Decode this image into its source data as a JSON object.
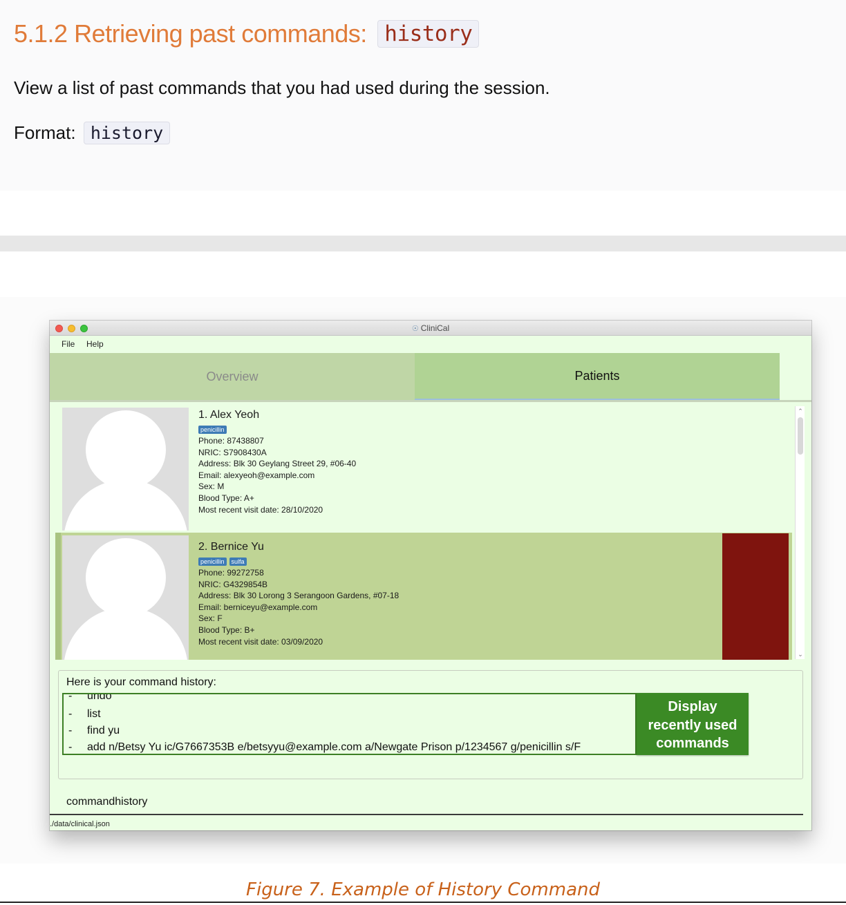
{
  "doc": {
    "heading_text": "5.1.2 Retrieving past commands:",
    "heading_code": "history",
    "description": "View a list of past commands that you had used during the session.",
    "format_label": "Format:",
    "format_code": "history",
    "caption": "Figure 7. Example of History Command"
  },
  "window": {
    "title": "CliniCal",
    "menu": {
      "file": "File",
      "help": "Help"
    },
    "tabs": {
      "overview": "Overview",
      "patients": "Patients"
    }
  },
  "patients": [
    {
      "name": "1.  Alex Yeoh",
      "tags": [
        "penicillin"
      ],
      "phone": "Phone: 87438807",
      "nric": "NRIC: S7908430A",
      "address": "Address: Blk 30 Geylang Street 29, #06-40",
      "email": "Email: alexyeoh@example.com",
      "sex": "Sex: M",
      "blood": "Blood Type: A+",
      "visit": "Most recent visit date: 28/10/2020"
    },
    {
      "name": "2.  Bernice Yu",
      "tags": [
        "penicillin",
        "sulfa"
      ],
      "phone": "Phone: 99272758",
      "nric": "NRIC: G4329854B",
      "address": "Address: Blk 30 Lorong 3 Serangoon Gardens, #07-18",
      "email": "Email: berniceyu@example.com",
      "sex": "Sex: F",
      "blood": "Blood Type: B+",
      "visit": "Most recent visit date: 03/09/2020"
    }
  ],
  "result": {
    "title": "Here is your command history:",
    "dash": "-",
    "history": [
      "undo",
      "list",
      "find yu",
      "add n/Betsy Yu ic/G7667353B e/betsyyu@example.com a/Newgate Prison p/1234567 g/penicillin s/F"
    ],
    "callout": [
      "Display",
      "recently used",
      "commands"
    ]
  },
  "command_box": {
    "value": "commandhistory"
  },
  "status_bar": {
    "path": "./data/clinical.json"
  },
  "colors": {
    "heading": "#e07b39",
    "caption": "#c8611a",
    "app_bg": "#ebfee4",
    "tab_overview": "#bfd6a6",
    "tab_patients": "#b0d394",
    "selected_card": "#bfd495",
    "tag": "#3e7bb5",
    "red_block": "#7f140e",
    "callout": "#3b8a25"
  },
  "icons": [
    "close-dot",
    "minimize-dot",
    "zoom-dot",
    "stethoscope-icon",
    "chevron-up-icon",
    "chevron-down-icon",
    "avatar-placeholder"
  ]
}
